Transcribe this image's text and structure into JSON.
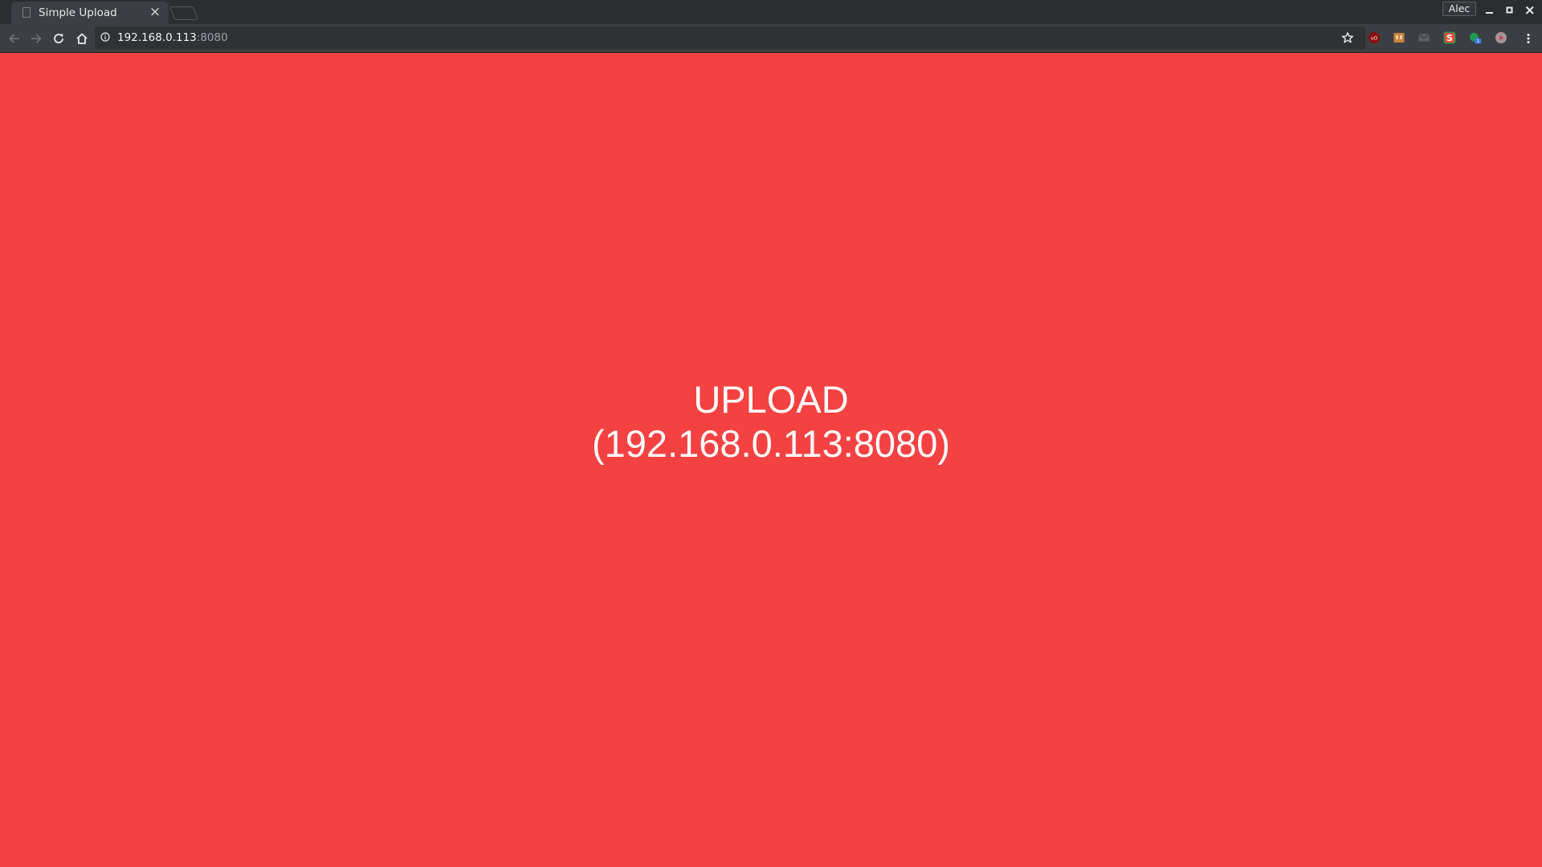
{
  "browser": {
    "tab": {
      "title": "Simple Upload",
      "close_glyph": "×",
      "favicon": "document-icon"
    },
    "new_tab": "new-tab-icon",
    "profile": "Alec",
    "window_controls": {
      "minimize": "minimize-icon",
      "maximize": "maximize-icon",
      "close": "close-icon"
    },
    "toolbar": {
      "back": "back-arrow-icon",
      "forward": "forward-arrow-icon",
      "reload": "reload-icon",
      "home": "home-icon"
    },
    "omnibox": {
      "host": "192.168.0.113",
      "port": ":8080",
      "security_icon": "info-icon",
      "bookmark_icon": "star-icon"
    },
    "extensions": [
      "ublock-icon",
      "extension-brown-icon",
      "mail-icon",
      "extension-s-icon",
      "extension-green-badge-icon",
      "extension-play-icon"
    ],
    "extension_badge": "1",
    "menu": "kebab-menu-icon"
  },
  "page": {
    "background": "#f44243",
    "upload_title": "UPLOAD",
    "upload_address": "(192.168.0.113:8080)"
  }
}
